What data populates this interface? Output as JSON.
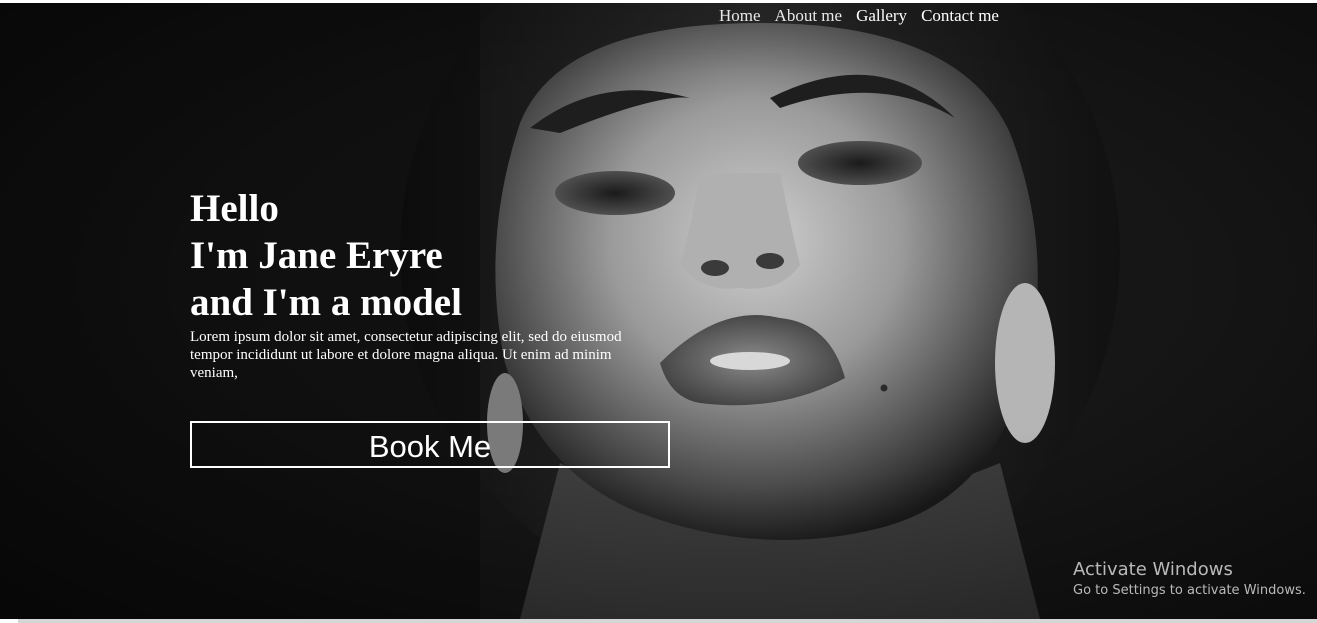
{
  "nav": {
    "items": [
      {
        "label": "Home"
      },
      {
        "label": "About me"
      },
      {
        "label": "Gallery"
      },
      {
        "label": "Contact me"
      }
    ]
  },
  "hero": {
    "headline_line1": "Hello",
    "headline_line2": "I'm Jane Eryre",
    "headline_line3": "and I'm a model",
    "description": "Lorem ipsum dolor sit amet, consectetur adipiscing elit, sed do eiusmod tempor incididunt ut labore et dolore magna aliqua. Ut enim ad minim veniam,",
    "cta_label": "Book Me"
  },
  "watermark": {
    "title": "Activate Windows",
    "subtitle": "Go to Settings to activate Windows."
  },
  "colors": {
    "background": "#151515",
    "text": "#ffffff",
    "watermark": "#b9b9b9"
  }
}
